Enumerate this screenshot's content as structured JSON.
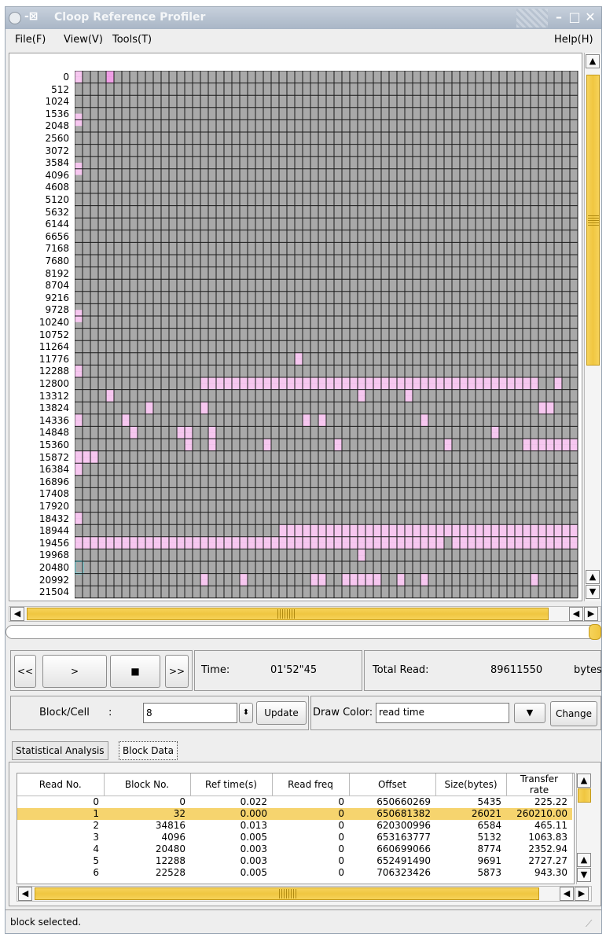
{
  "window": {
    "title": "Cloop Reference Profiler"
  },
  "menu": {
    "file": "File(F)",
    "view": "View(V)",
    "tools": "Tools(T)",
    "help": "Help(H)"
  },
  "grid": {
    "row_labels": [
      "0",
      "512",
      "1024",
      "1536",
      "2048",
      "2560",
      "3072",
      "3584",
      "4096",
      "4608",
      "5120",
      "5632",
      "6144",
      "6656",
      "7168",
      "7680",
      "8192",
      "8704",
      "9216",
      "9728",
      "10240",
      "10752",
      "11264",
      "11776",
      "12288",
      "12800",
      "13312",
      "13824",
      "14336",
      "14848",
      "15360",
      "15872",
      "16384",
      "16896",
      "17408",
      "17920",
      "18432",
      "18944",
      "19456",
      "19968",
      "20480",
      "20992",
      "21504"
    ],
    "colors": {
      "empty": "#a9a9a9",
      "read": "#f7c7f0",
      "selected": "#f09ee6",
      "cursor": "#7fe6ef",
      "line": "#1a1a1a"
    }
  },
  "controls": {
    "rewind_label": "<<",
    "play_label": ">",
    "stop_label": "■",
    "forward_label": ">>",
    "time_label": "Time:",
    "time_value": "01'52\"45",
    "total_read_label": "Total Read:",
    "total_read_value": "89611550",
    "total_read_unit": "bytes",
    "block_cell_label": "Block/Cell",
    "colon": ":",
    "block_cell_value": "8",
    "update_label": "Update",
    "draw_color_label": "Draw Color:",
    "draw_color_value": "read time",
    "change_label": "Change"
  },
  "tabs": [
    "Statistical Analysis",
    "Block Data"
  ],
  "table": {
    "columns": [
      "Read No.",
      "Block No.",
      "Ref time(s)",
      "Read freq",
      "Offset",
      "Size(bytes)",
      "Transfer rate"
    ],
    "rows": [
      [
        "0",
        "0",
        "0.022",
        "0",
        "650660269",
        "5435",
        "225.22"
      ],
      [
        "1",
        "32",
        "0.000",
        "0",
        "650681382",
        "26021",
        "260210.00"
      ],
      [
        "2",
        "34816",
        "0.013",
        "0",
        "620300996",
        "6584",
        "465.11"
      ],
      [
        "3",
        "4096",
        "0.005",
        "0",
        "653163777",
        "5132",
        "1063.83"
      ],
      [
        "4",
        "20480",
        "0.003",
        "0",
        "660699066",
        "8774",
        "2352.94"
      ],
      [
        "5",
        "12288",
        "0.003",
        "0",
        "652491490",
        "9691",
        "2727.27"
      ],
      [
        "6",
        "22528",
        "0.005",
        "0",
        "706323426",
        "5873",
        "943.30"
      ]
    ],
    "selected_row": 1
  },
  "status": {
    "text": "block selected."
  }
}
